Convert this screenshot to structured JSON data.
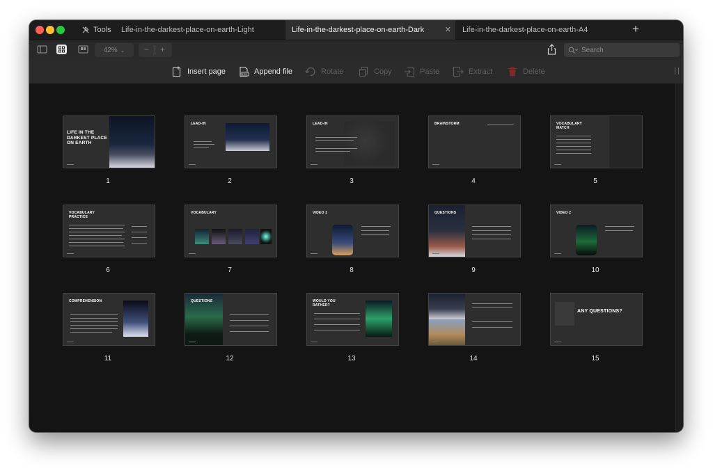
{
  "window": {
    "tools_label": "Tools",
    "tabs": [
      {
        "label": "Life-in-the-darkest-place-on-earth-Light"
      },
      {
        "label": "Life-in-the-darkest-place-on-earth-Dark",
        "active": true
      },
      {
        "label": "Life-in-the-darkest-place-on-earth-A4"
      }
    ]
  },
  "toolbar": {
    "zoom": "42%",
    "search_placeholder": "Search"
  },
  "actions": [
    {
      "label": "Insert page",
      "enabled": true,
      "icon": "insert-page-icon"
    },
    {
      "label": "Append file",
      "enabled": true,
      "icon": "append-file-icon"
    },
    {
      "label": "Rotate",
      "enabled": false,
      "icon": "rotate-icon"
    },
    {
      "label": "Copy",
      "enabled": false,
      "icon": "copy-icon"
    },
    {
      "label": "Paste",
      "enabled": false,
      "icon": "paste-icon"
    },
    {
      "label": "Extract",
      "enabled": false,
      "icon": "extract-icon"
    },
    {
      "label": "Delete",
      "enabled": false,
      "icon": "delete-icon"
    }
  ],
  "pages": [
    {
      "number": "1",
      "title": "LIFE IN THE DARKEST PLACE ON EARTH"
    },
    {
      "number": "2",
      "title": "LEAD-IN"
    },
    {
      "number": "3",
      "title": "LEAD-IN"
    },
    {
      "number": "4",
      "title": "BRAINSTORM"
    },
    {
      "number": "5",
      "title": "VOCABULARY MATCH"
    },
    {
      "number": "6",
      "title": "VOCABULARY PRACTICE"
    },
    {
      "number": "7",
      "title": "VOCABULARY"
    },
    {
      "number": "8",
      "title": "VIDEO 1"
    },
    {
      "number": "9",
      "title": "QUESTIONS"
    },
    {
      "number": "10",
      "title": "VIDEO 2"
    },
    {
      "number": "11",
      "title": "COMPREHENSION"
    },
    {
      "number": "12",
      "title": "QUESTIONS"
    },
    {
      "number": "13",
      "title": "WOULD YOU RATHER?"
    },
    {
      "number": "14",
      "title": ""
    },
    {
      "number": "15",
      "title": "ANY QUESTIONS?"
    }
  ],
  "colors": {
    "window_bg": "#141414",
    "thumb_bg": "#2e2e2e",
    "delete_icon": "#7a2b2b",
    "close_red": "#fe5f57",
    "minimize_yellow": "#febc2e",
    "zoom_green": "#28c840"
  }
}
